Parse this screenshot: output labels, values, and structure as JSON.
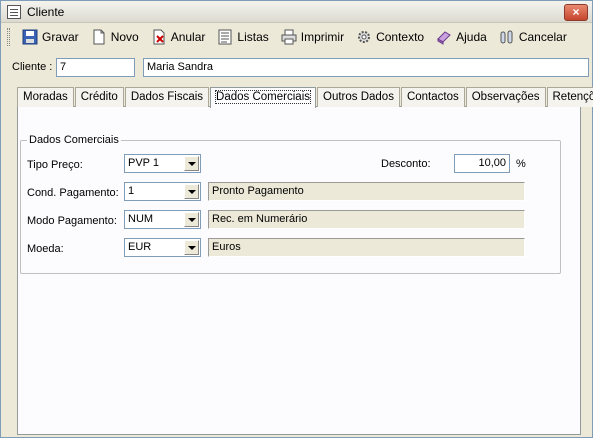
{
  "window": {
    "title": "Cliente",
    "close_label": "×"
  },
  "toolbar": {
    "items": [
      {
        "label": "Gravar",
        "icon": "floppy-disk-icon"
      },
      {
        "label": "Novo",
        "icon": "new-document-icon"
      },
      {
        "label": "Anular",
        "icon": "cancel-document-icon"
      },
      {
        "label": "Listas",
        "icon": "list-icon"
      },
      {
        "label": "Imprimir",
        "icon": "printer-icon"
      },
      {
        "label": "Contexto",
        "icon": "gear-icon"
      },
      {
        "label": "Ajuda",
        "icon": "help-book-icon"
      },
      {
        "label": "Cancelar",
        "icon": "cancel-icon"
      }
    ]
  },
  "client": {
    "label": "Cliente :",
    "code": "7",
    "name": "Maria Sandra"
  },
  "tabs": [
    {
      "label": "Moradas",
      "active": false
    },
    {
      "label": "Crédito",
      "active": false
    },
    {
      "label": "Dados Fiscais",
      "active": false
    },
    {
      "label": "Dados Comerciais",
      "active": true
    },
    {
      "label": "Outros Dados",
      "active": false
    },
    {
      "label": "Contactos",
      "active": false
    },
    {
      "label": "Observações",
      "active": false
    },
    {
      "label": "Retenções",
      "active": false
    }
  ],
  "commercial": {
    "group_title": "Dados Comerciais",
    "price_type": {
      "label": "Tipo Preço:",
      "value": "PVP 1"
    },
    "discount": {
      "label": "Desconto:",
      "value": "10,00",
      "unit": "%"
    },
    "payment_cond": {
      "label": "Cond. Pagamento:",
      "value": "1",
      "description": "Pronto Pagamento"
    },
    "payment_mode": {
      "label": "Modo Pagamento:",
      "value": "NUM",
      "description": "Rec. em Numerário"
    },
    "currency": {
      "label": "Moeda:",
      "value": "EUR",
      "description": "Euros"
    }
  },
  "colors": {
    "face": "#ece9d8",
    "panel": "#fcfcfe",
    "border": "#7f9db9",
    "close": "#c4462c"
  }
}
